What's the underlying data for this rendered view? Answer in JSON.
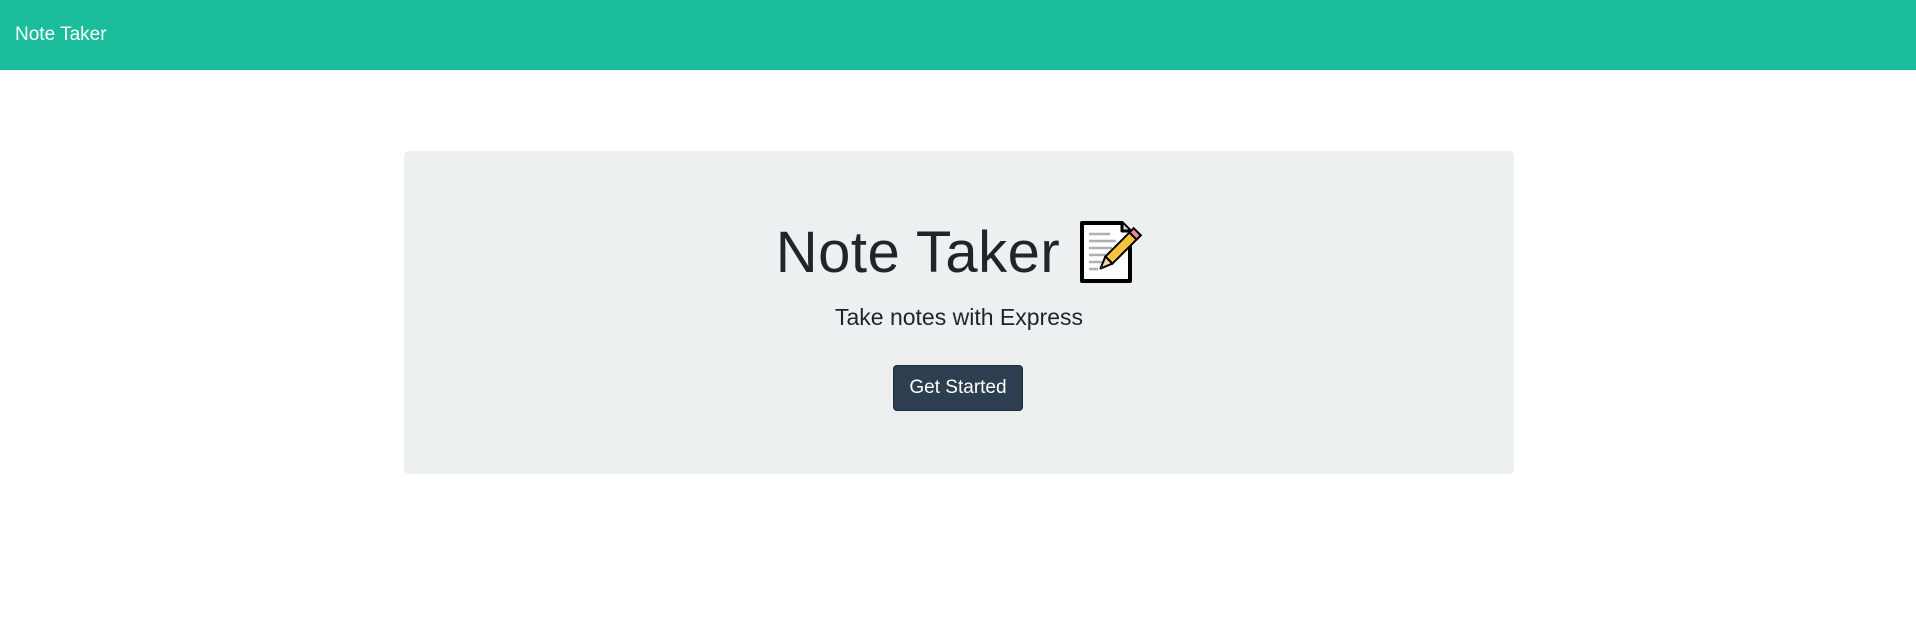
{
  "navbar": {
    "brand": "Note Taker",
    "background_color": "#1abc9c"
  },
  "hero": {
    "title": "Note Taker",
    "title_icon": "memo-icon",
    "subtitle": "Take notes with Express",
    "button_label": "Get Started",
    "background_color": "#ecf0f1",
    "button_color": "#2c3e50"
  }
}
